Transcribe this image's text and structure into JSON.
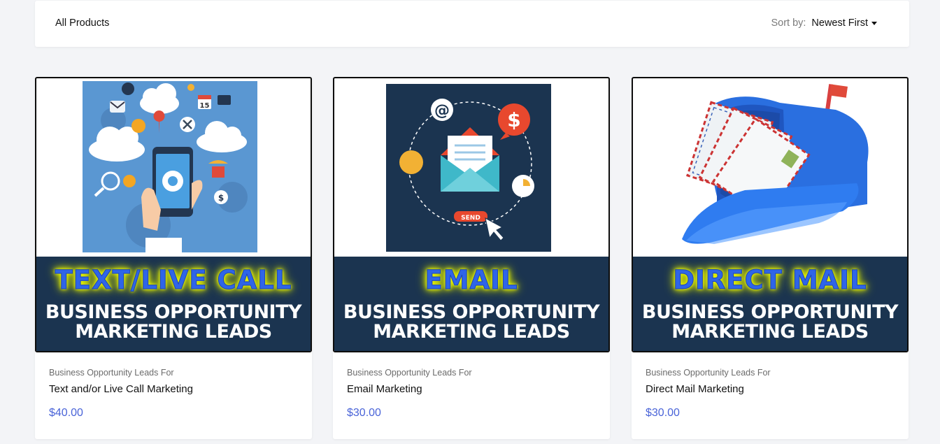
{
  "header": {
    "title": "All Products",
    "sort_label": "Sort by:",
    "sort_value": "Newest First"
  },
  "products": [
    {
      "headline": "TEXT/LIVE CALL",
      "sub1": "BUSINESS OPPORTUNITY",
      "sub2": "MARKETING LEADS",
      "category": "Business Opportunity Leads For",
      "name": "Text and/or Live Call Marketing",
      "price": "$40.00",
      "art_text": {
        "calendar": "15",
        "dollar": "$"
      }
    },
    {
      "headline": "EMAIL",
      "sub1": "BUSINESS OPPORTUNITY",
      "sub2": "MARKETING LEADS",
      "category": "Business Opportunity Leads For",
      "name": "Email Marketing",
      "price": "$30.00",
      "art_text": {
        "at": "@",
        "dollar": "$",
        "send": "SEND"
      }
    },
    {
      "headline": "DIRECT MAIL",
      "sub1": "BUSINESS OPPORTUNITY",
      "sub2": "MARKETING LEADS",
      "category": "Business Opportunity Leads For",
      "name": "Direct Mail Marketing",
      "price": "$30.00"
    }
  ],
  "colors": {
    "background": "#f3f4f7",
    "banner": "#1b3450",
    "headline": "#2f65e8",
    "headline_glow": "#f6ff00",
    "price": "#4a64d8"
  }
}
